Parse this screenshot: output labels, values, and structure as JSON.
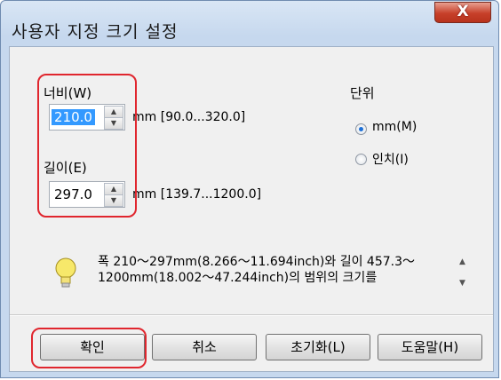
{
  "window": {
    "title": "사용자 지정 크기 설정",
    "close_glyph": "X"
  },
  "width": {
    "label": "너비(W)",
    "value": "210.0",
    "range": "mm [90.0...320.0]"
  },
  "length": {
    "label": "길이(E)",
    "value": "297.0",
    "range": "mm [139.7...1200.0]"
  },
  "unit": {
    "label": "단위",
    "options": [
      {
        "label": "mm(M)",
        "selected": true
      },
      {
        "label": "인치(I)",
        "selected": false
      }
    ]
  },
  "hint": {
    "icon": "lightbulb-icon",
    "text": "폭 210～297mm(8.266～11.694inch)와 길이 457.3～1200mm(18.002～47.244inch)의 범위의 크기를"
  },
  "buttons": {
    "ok": "확인",
    "cancel": "취소",
    "reset": "초기화(L)",
    "help": "도움말(H)"
  },
  "colors": {
    "highlight": "#e0262e",
    "selection": "#3399ff"
  }
}
